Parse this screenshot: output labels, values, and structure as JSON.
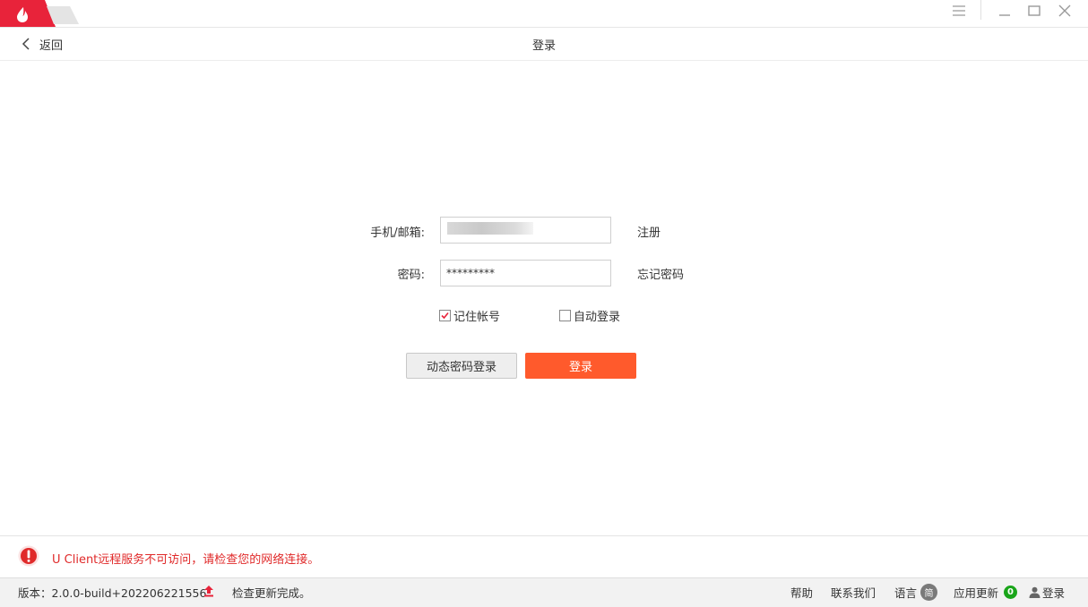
{
  "nav": {
    "back_label": "返回",
    "title": "登录"
  },
  "form": {
    "account_label": "手机/邮箱:",
    "password_label": "密码:",
    "password_value": "*********",
    "register_link": "注册",
    "forgot_link": "忘记密码",
    "remember_label": "记住帐号",
    "remember_checked": true,
    "autologin_label": "自动登录",
    "autologin_checked": false,
    "dynamic_login_button": "动态密码登录",
    "login_button": "登录"
  },
  "error": {
    "message": "U Client远程服务不可访问，请检查您的网络连接。"
  },
  "status": {
    "version": "版本：2.0.0-build+202206221556",
    "update_status": "检查更新完成。",
    "help": "帮助",
    "contact": "联系我们",
    "language": "语言",
    "language_badge": "简",
    "app_update": "应用更新",
    "app_update_count": "0",
    "login": "登录"
  },
  "colors": {
    "brand_red": "#e8233a",
    "primary": "#ff5a2c",
    "error_red": "#e02a2a",
    "success_green": "#1aa51a"
  },
  "icons": [
    "app-logo-icon",
    "menu-icon",
    "minimize-icon",
    "maximize-icon",
    "close-icon",
    "chevron-left-icon",
    "error-icon",
    "upload-arrow-icon",
    "user-icon"
  ]
}
